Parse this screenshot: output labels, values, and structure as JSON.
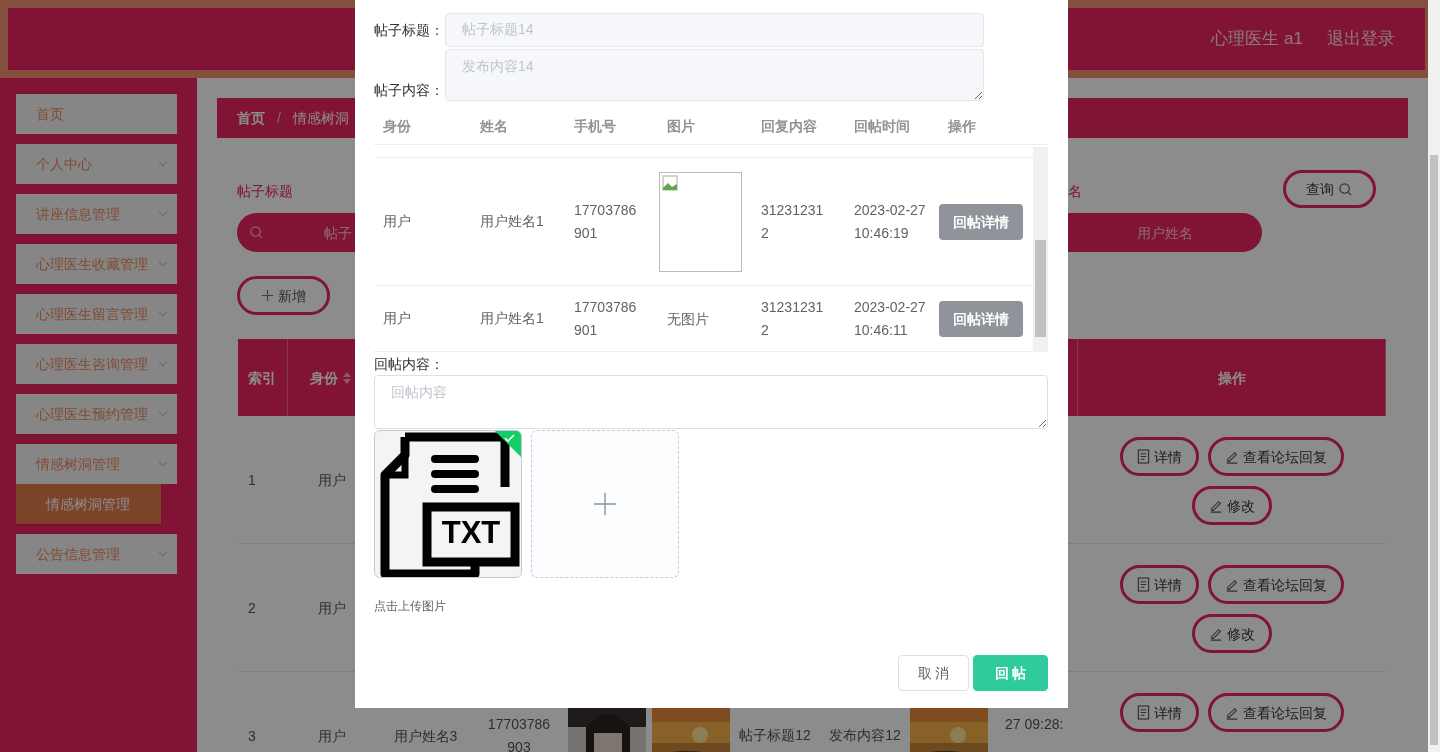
{
  "header": {
    "user": "心理医生 a1",
    "logout": "退出登录"
  },
  "sidebar": {
    "items": [
      {
        "label": "首页",
        "kind": "link"
      },
      {
        "label": "个人中心",
        "kind": "menu",
        "expanded": false
      },
      {
        "label": "讲座信息管理",
        "kind": "menu",
        "expanded": false
      },
      {
        "label": "心理医生收藏管理",
        "kind": "menu",
        "expanded": false
      },
      {
        "label": "心理医生留言管理",
        "kind": "menu",
        "expanded": false
      },
      {
        "label": "心理医生咨询管理",
        "kind": "menu",
        "expanded": false
      },
      {
        "label": "心理医生预约管理",
        "kind": "menu",
        "expanded": false
      },
      {
        "label": "情感树洞管理",
        "kind": "menu",
        "expanded": true,
        "children": [
          {
            "label": "情感树洞管理",
            "selected": true
          }
        ]
      },
      {
        "label": "公告信息管理",
        "kind": "menu",
        "expanded": false
      }
    ]
  },
  "breadcrumb": {
    "items": [
      "首页",
      "情感树洞"
    ],
    "separator": "/"
  },
  "search": {
    "fields": [
      {
        "label": "帖子标题",
        "placeholder": "帖子"
      },
      {
        "label": "名",
        "placeholder": "用户姓名"
      }
    ],
    "button": "查询"
  },
  "add_button": "新增",
  "table": {
    "columns": [
      {
        "label": "索引",
        "sortable": false
      },
      {
        "label": "身份",
        "sortable": true
      },
      {
        "label": "操作",
        "sortable": false
      }
    ],
    "rows": [
      {
        "index": "1",
        "identity": "用户",
        "actions": [
          {
            "label": "详情",
            "kind": "detail"
          },
          {
            "label": "查看论坛回复",
            "kind": "edit"
          },
          {
            "label": "修改",
            "kind": "edit"
          }
        ]
      },
      {
        "index": "2",
        "identity": "用户",
        "actions": [
          {
            "label": "详情",
            "kind": "detail"
          },
          {
            "label": "查看论坛回复",
            "kind": "edit"
          },
          {
            "label": "修改",
            "kind": "edit"
          }
        ]
      },
      {
        "index": "3",
        "identity": "用户",
        "name": "用户姓名3",
        "phone": "17703786903",
        "title": "帖子标题12",
        "content": "发布内容12",
        "time": "27 09:28:",
        "actions": [
          {
            "label": "详情",
            "kind": "detail"
          },
          {
            "label": "查看论坛回复",
            "kind": "edit"
          }
        ]
      }
    ]
  },
  "dialog": {
    "fields": [
      {
        "label": "帖子标题：",
        "value": "帖子标题14",
        "multiline": false,
        "disabled": true
      },
      {
        "label": "帖子内容：",
        "value": "发布内容14",
        "multiline": true,
        "disabled": true
      }
    ],
    "replies": {
      "columns": [
        "身份",
        "姓名",
        "手机号",
        "图片",
        "回复内容",
        "回帖时间",
        "操作"
      ],
      "rows": [
        {
          "identity": "用户",
          "name": "用户姓名1",
          "phone": "17703786901",
          "kind": "with_image",
          "content": "312312312",
          "time": "2023-02-27 10:46:19",
          "action": "回帖详情"
        },
        {
          "identity": "用户",
          "name": "用户姓名1",
          "phone": "17703786901",
          "kind": "without_image",
          "image_text": "无图片",
          "content": "312312312",
          "time": "2023-02-27 10:46:11",
          "action": "回帖详情"
        }
      ]
    },
    "reply_field": {
      "label": "回帖内容：",
      "placeholder": "回帖内容"
    },
    "upload": {
      "files": [
        {
          "label": "TXT",
          "uploaded": true
        }
      ],
      "hint": "点击上传图片"
    },
    "buttons": [
      {
        "label": "取 消",
        "kind": "secondary"
      },
      {
        "label": "回 帖",
        "kind": "primary"
      }
    ]
  }
}
